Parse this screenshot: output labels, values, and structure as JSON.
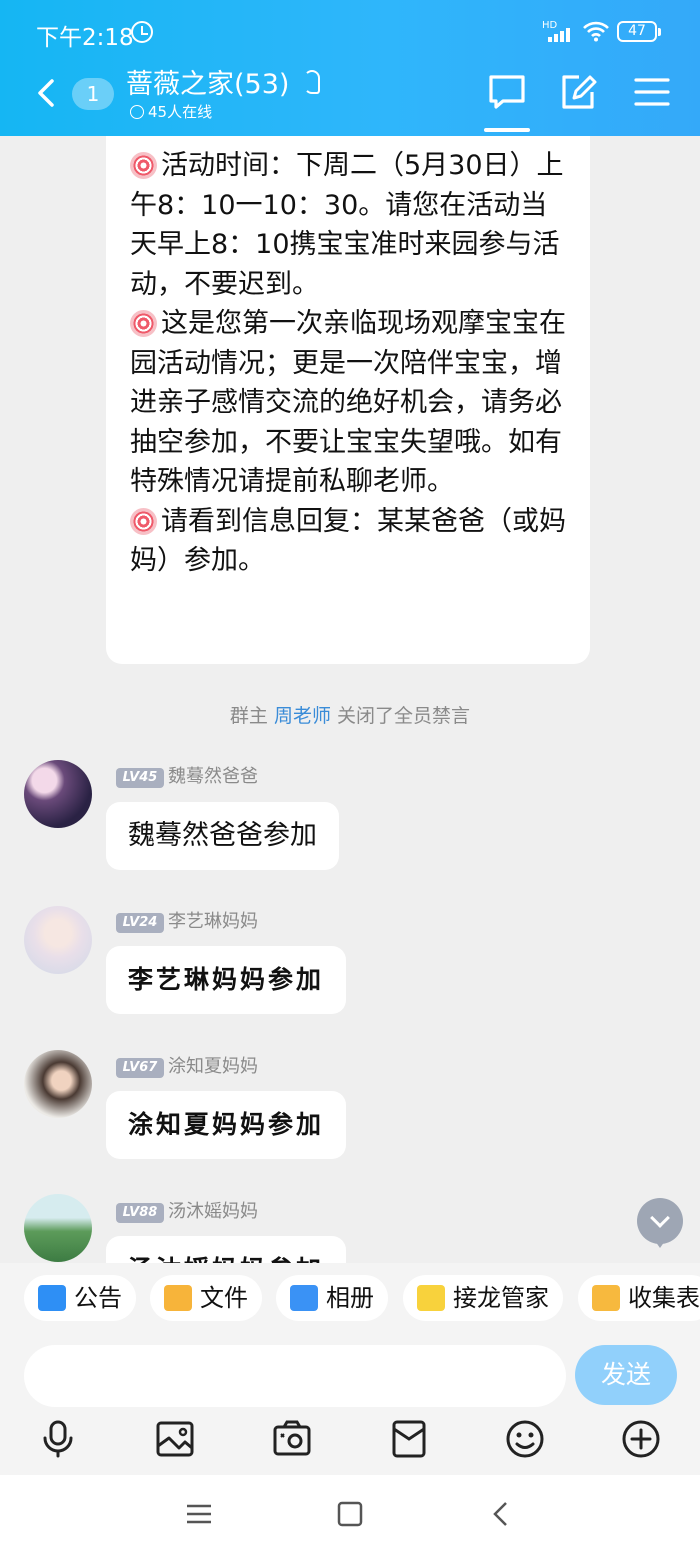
{
  "status_bar": {
    "time": "下午2:18",
    "network": "HD",
    "battery": "47"
  },
  "header": {
    "unread_count": "1",
    "group_title": "蔷薇之家(53)",
    "online_text": "45人在线"
  },
  "announcement": {
    "lines": [
      "活动时间：下周二（5月30日）上午8：10一10：30。请您在活动当天早上8：10携宝宝准时来园参与活动，不要迟到。",
      "这是您第一次亲临现场观摩宝宝在园活动情况；更是一次陪伴宝宝，增进亲子感情交流的绝好机会，请务必抽空参加，不要让宝宝失望哦。如有特殊情况请提前私聊老师。",
      "请看到信息回复：某某爸爸（或妈妈）参加。"
    ]
  },
  "system_notice": {
    "prefix": "群主",
    "who": "周老师",
    "suffix": "关闭了全员禁言"
  },
  "messages": [
    {
      "level": "LV45",
      "name": "魏蓦然爸爸",
      "text": "魏蓦然爸爸参加"
    },
    {
      "level": "LV24",
      "name": "李艺琳妈妈",
      "text": "李艺琳妈妈参加"
    },
    {
      "level": "LV67",
      "name": "涂知夏妈妈",
      "text": "涂知夏妈妈参加"
    },
    {
      "level": "LV88",
      "name": "汤沐媱妈妈",
      "text": "汤沐媱妈妈参加"
    }
  ],
  "quick_bar": [
    {
      "label": "公告",
      "icon": "announcement-icon",
      "color": "#2e8ff5"
    },
    {
      "label": "文件",
      "icon": "folder-icon",
      "color": "#f7b43a"
    },
    {
      "label": "相册",
      "icon": "album-icon",
      "color": "#3a92f5"
    },
    {
      "label": "接龙管家",
      "icon": "relay-icon",
      "color": "#f8d23c"
    },
    {
      "label": "收集表",
      "icon": "form-icon",
      "color": "#f7b93e"
    }
  ],
  "input": {
    "placeholder": "",
    "send_label": "发送"
  },
  "colors": {
    "header": "#2fb6fb",
    "send": "#91d0fb",
    "link": "#3a8cd8"
  }
}
